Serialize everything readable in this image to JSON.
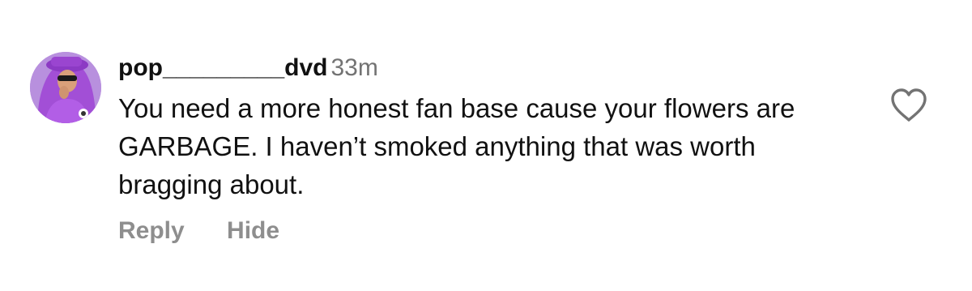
{
  "comment": {
    "username": "pop_________dvd",
    "timestamp": "33m",
    "text": "You need a more honest fan base cause your flowers are GARBAGE. I haven’t smoked anything that was worth bragging about.",
    "avatar_icon": "user-avatar-icon",
    "like_icon": "heart-icon"
  },
  "actions": {
    "reply_label": "Reply",
    "hide_label": "Hide"
  },
  "colors": {
    "text": "#111111",
    "secondary": "#737373",
    "action": "#8e8e8e",
    "avatar_bg": "#b890de"
  }
}
